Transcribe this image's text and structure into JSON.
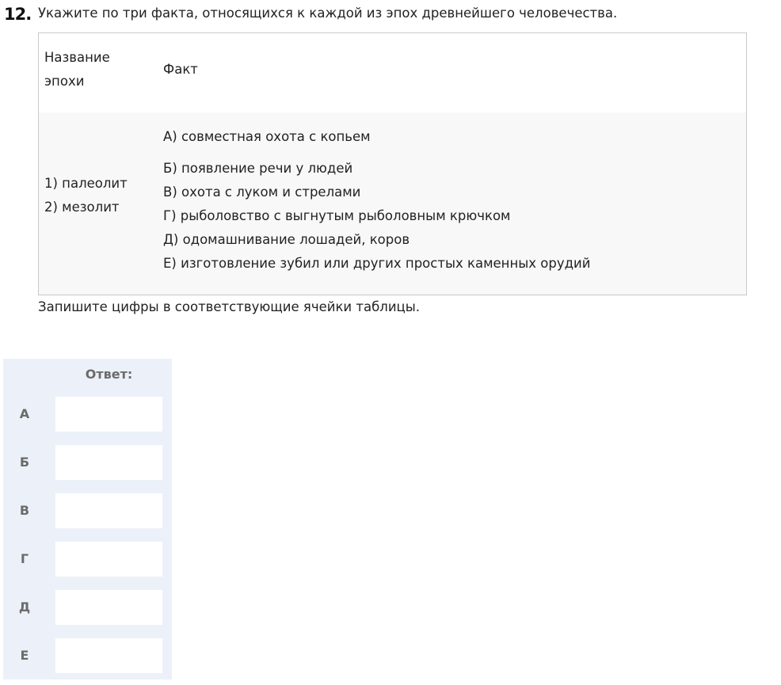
{
  "question": {
    "number": "12.",
    "text": "Укажите по три факта, относящихся к каждой из  эпох древнейшего человечества."
  },
  "table": {
    "headers": {
      "epoch_line1": "Название",
      "epoch_line2": "эпохи",
      "fact": "Факт"
    },
    "epochs": [
      "1) палеолит",
      "2) мезолит"
    ],
    "facts": [
      "А) совместная охота с копьем",
      "Б) появление речи у людей",
      "В) охота с луком и стрелами",
      "Г) рыболовство с выгнутым рыболовным крючком",
      "Д) одомашнивание лошадей, коров",
      "Е) изготовление зубил или других простых каменных орудий"
    ]
  },
  "instruction": "Запишите цифры в соответствующие ячейки таблицы.",
  "answer": {
    "title": "Ответ:",
    "rows": [
      {
        "letter": "А",
        "value": ""
      },
      {
        "letter": "Б",
        "value": ""
      },
      {
        "letter": "В",
        "value": ""
      },
      {
        "letter": "Г",
        "value": ""
      },
      {
        "letter": "Д",
        "value": ""
      },
      {
        "letter": "Е",
        "value": ""
      }
    ]
  }
}
